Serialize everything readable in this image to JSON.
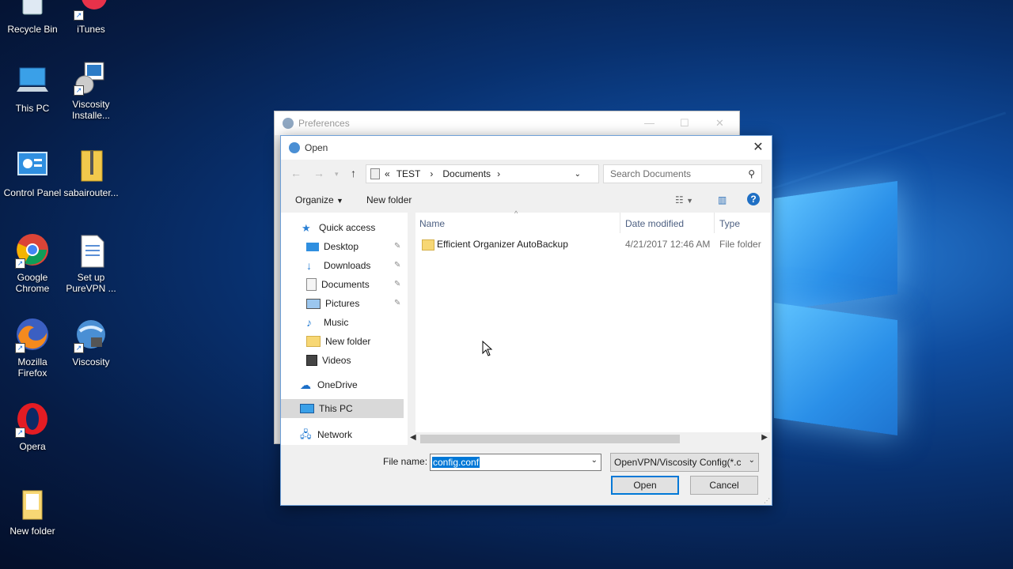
{
  "desktop": {
    "icons": [
      {
        "label": "Recycle Bin",
        "icon": "recycle-bin-icon"
      },
      {
        "label": "iTunes",
        "icon": "itunes-icon"
      },
      {
        "label": "This PC",
        "icon": "this-pc-icon"
      },
      {
        "label": "Viscosity Installe...",
        "icon": "installer-icon"
      },
      {
        "label": "Control Panel",
        "icon": "control-panel-icon"
      },
      {
        "label": "sabairouter...",
        "icon": "zip-folder-icon"
      },
      {
        "label": "Google Chrome",
        "icon": "chrome-icon"
      },
      {
        "label": "Set up PureVPN ...",
        "icon": "document-icon"
      },
      {
        "label": "Mozilla Firefox",
        "icon": "firefox-icon"
      },
      {
        "label": "Viscosity",
        "icon": "viscosity-icon"
      },
      {
        "label": "Opera",
        "icon": "opera-icon"
      },
      {
        "label": "New folder",
        "icon": "folder-icon"
      }
    ]
  },
  "preferences_window": {
    "title": "Preferences"
  },
  "open_dialog": {
    "title": "Open",
    "address": {
      "prefix": "«",
      "parts": [
        "TEST",
        "Documents"
      ]
    },
    "search_placeholder": "Search Documents",
    "toolbar": {
      "organize": "Organize",
      "new_folder": "New folder"
    },
    "nav": {
      "quick_access": "Quick access",
      "items": [
        "Desktop",
        "Downloads",
        "Documents",
        "Pictures",
        "Music",
        "New folder",
        "Videos"
      ],
      "onedrive": "OneDrive",
      "this_pc": "This PC",
      "network": "Network"
    },
    "columns": {
      "name": "Name",
      "date_modified": "Date modified",
      "type": "Type"
    },
    "files": [
      {
        "name": "Efficient Organizer AutoBackup",
        "date": "4/21/2017 12:46 AM",
        "type": "File folder"
      }
    ],
    "file_name_label": "File name:",
    "file_name_value": "config.conf",
    "file_type": "OpenVPN/Viscosity Config(*.cc",
    "open_button": "Open",
    "cancel_button": "Cancel"
  },
  "colors": {
    "accent": "#0078d7",
    "selection": "#cce8ff"
  }
}
